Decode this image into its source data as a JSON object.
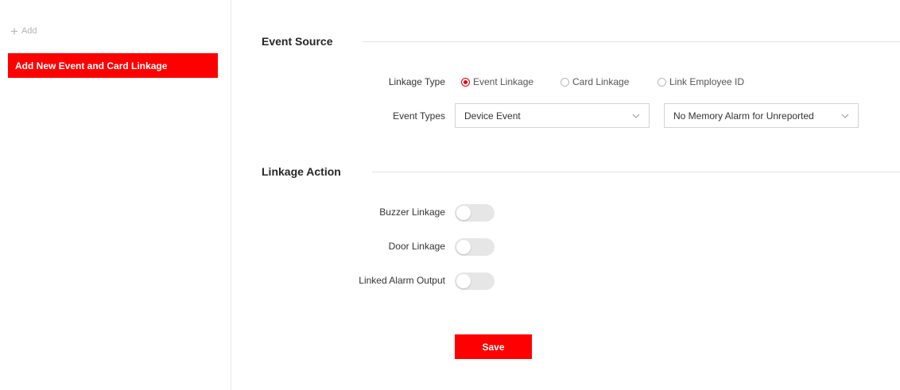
{
  "sidebar": {
    "add_label": "Add",
    "items": [
      {
        "label": "Add New Event and Card Linkage",
        "active": true
      }
    ]
  },
  "event_source": {
    "title": "Event Source",
    "linkage_type": {
      "label": "Linkage Type",
      "options": [
        {
          "label": "Event Linkage",
          "selected": true
        },
        {
          "label": "Card Linkage",
          "selected": false
        },
        {
          "label": "Link Employee ID",
          "selected": false
        }
      ]
    },
    "event_types": {
      "label": "Event Types",
      "primary_value": "Device Event",
      "secondary_value": "No Memory Alarm for Unreported"
    }
  },
  "linkage_action": {
    "title": "Linkage Action",
    "toggles": [
      {
        "label": "Buzzer Linkage",
        "enabled": false
      },
      {
        "label": "Door Linkage",
        "enabled": false
      },
      {
        "label": "Linked Alarm Output",
        "enabled": false
      }
    ]
  },
  "actions": {
    "save_label": "Save"
  },
  "colors": {
    "accent": "#ff0000",
    "radio_checked": "#e60012",
    "toggle_off": "#e6e6e6"
  }
}
